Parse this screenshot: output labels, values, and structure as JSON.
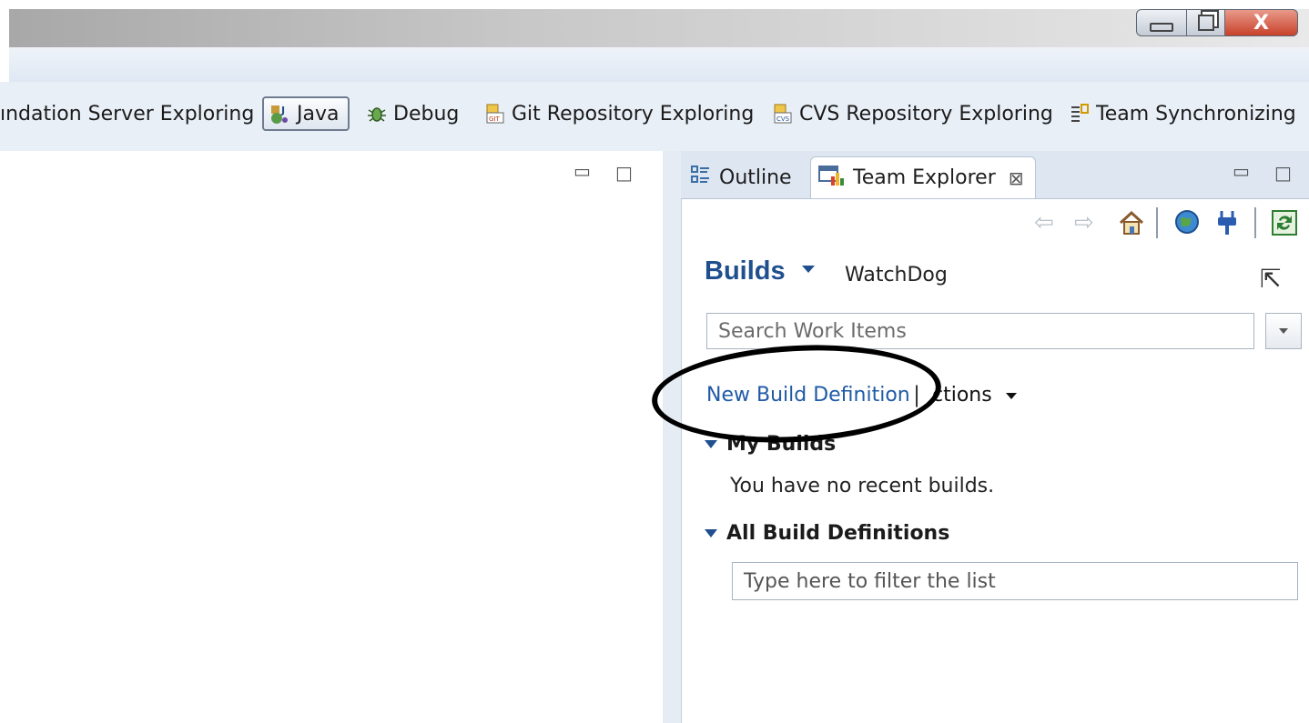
{
  "window": {
    "close_label": "X"
  },
  "perspectives": [
    {
      "label": "ındation Server Exploring",
      "icon": "tfs-icon"
    },
    {
      "label": "Java",
      "icon": "java-perspective-icon",
      "selected": true
    },
    {
      "label": "Debug",
      "icon": "bug-icon"
    },
    {
      "label": "Git Repository Exploring",
      "icon": "git-icon"
    },
    {
      "label": "CVS Repository Exploring",
      "icon": "cvs-icon"
    },
    {
      "label": "Team Synchronizing",
      "icon": "team-sync-icon"
    }
  ],
  "view": {
    "tabs": [
      {
        "label": "Outline",
        "icon": "outline-icon"
      },
      {
        "label": "Team Explorer",
        "icon": "team-explorer-icon",
        "close": "⊠"
      }
    ],
    "page_title": "Builds",
    "context": "WatchDog",
    "search_placeholder": "Search Work Items",
    "new_build_link": "New Build Definition",
    "separator": "|",
    "actions_label": "ctions",
    "my_builds_header": "My Builds",
    "no_builds_text": "You have no recent builds.",
    "all_defs_header": "All Build Definitions",
    "filter_placeholder": "Type here to filter the list"
  },
  "colors": {
    "link": "#1f5aa6",
    "title": "#1f4f8e",
    "toolbar_bg": "#e9eff7"
  }
}
